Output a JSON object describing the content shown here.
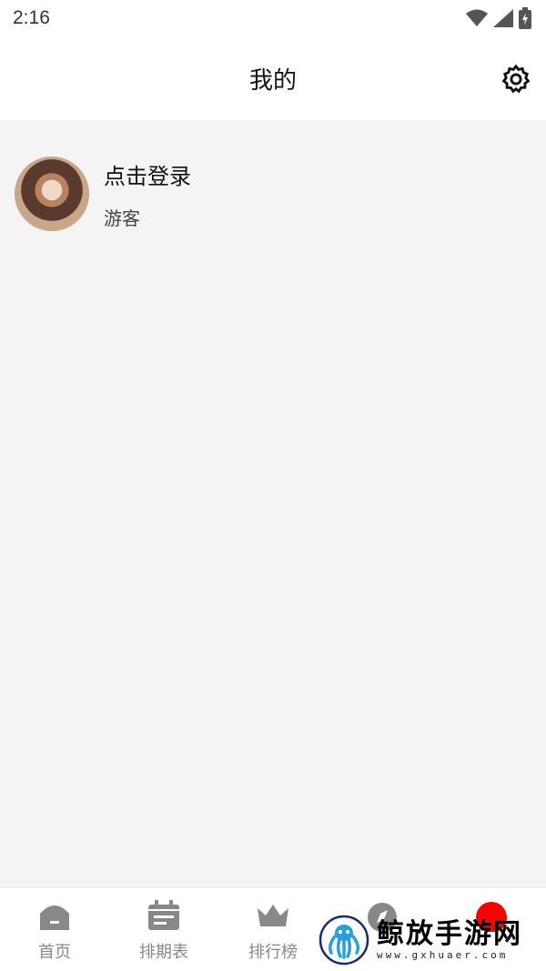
{
  "status_bar": {
    "time": "2:16",
    "icons": [
      "wifi-icon",
      "signal-icon",
      "battery-icon"
    ]
  },
  "header": {
    "title": "我的",
    "settings_icon": "gear-icon"
  },
  "profile": {
    "login_text": "点击登录",
    "role": "游客"
  },
  "tabbar": {
    "items": [
      {
        "label": "首页",
        "icon": "home-icon"
      },
      {
        "label": "排期表",
        "icon": "calendar-icon"
      },
      {
        "label": "排行榜",
        "icon": "crown-icon"
      },
      {
        "label": "",
        "icon": "compass-icon"
      },
      {
        "label": "",
        "icon": "profile-icon"
      }
    ]
  },
  "watermark": {
    "name": "鲸放手游网",
    "url": "www.gxhuaer.com"
  },
  "colors": {
    "content_bg": "#f4f4f4",
    "tab_inactive": "#888888",
    "tab_active": "#ff0000"
  }
}
